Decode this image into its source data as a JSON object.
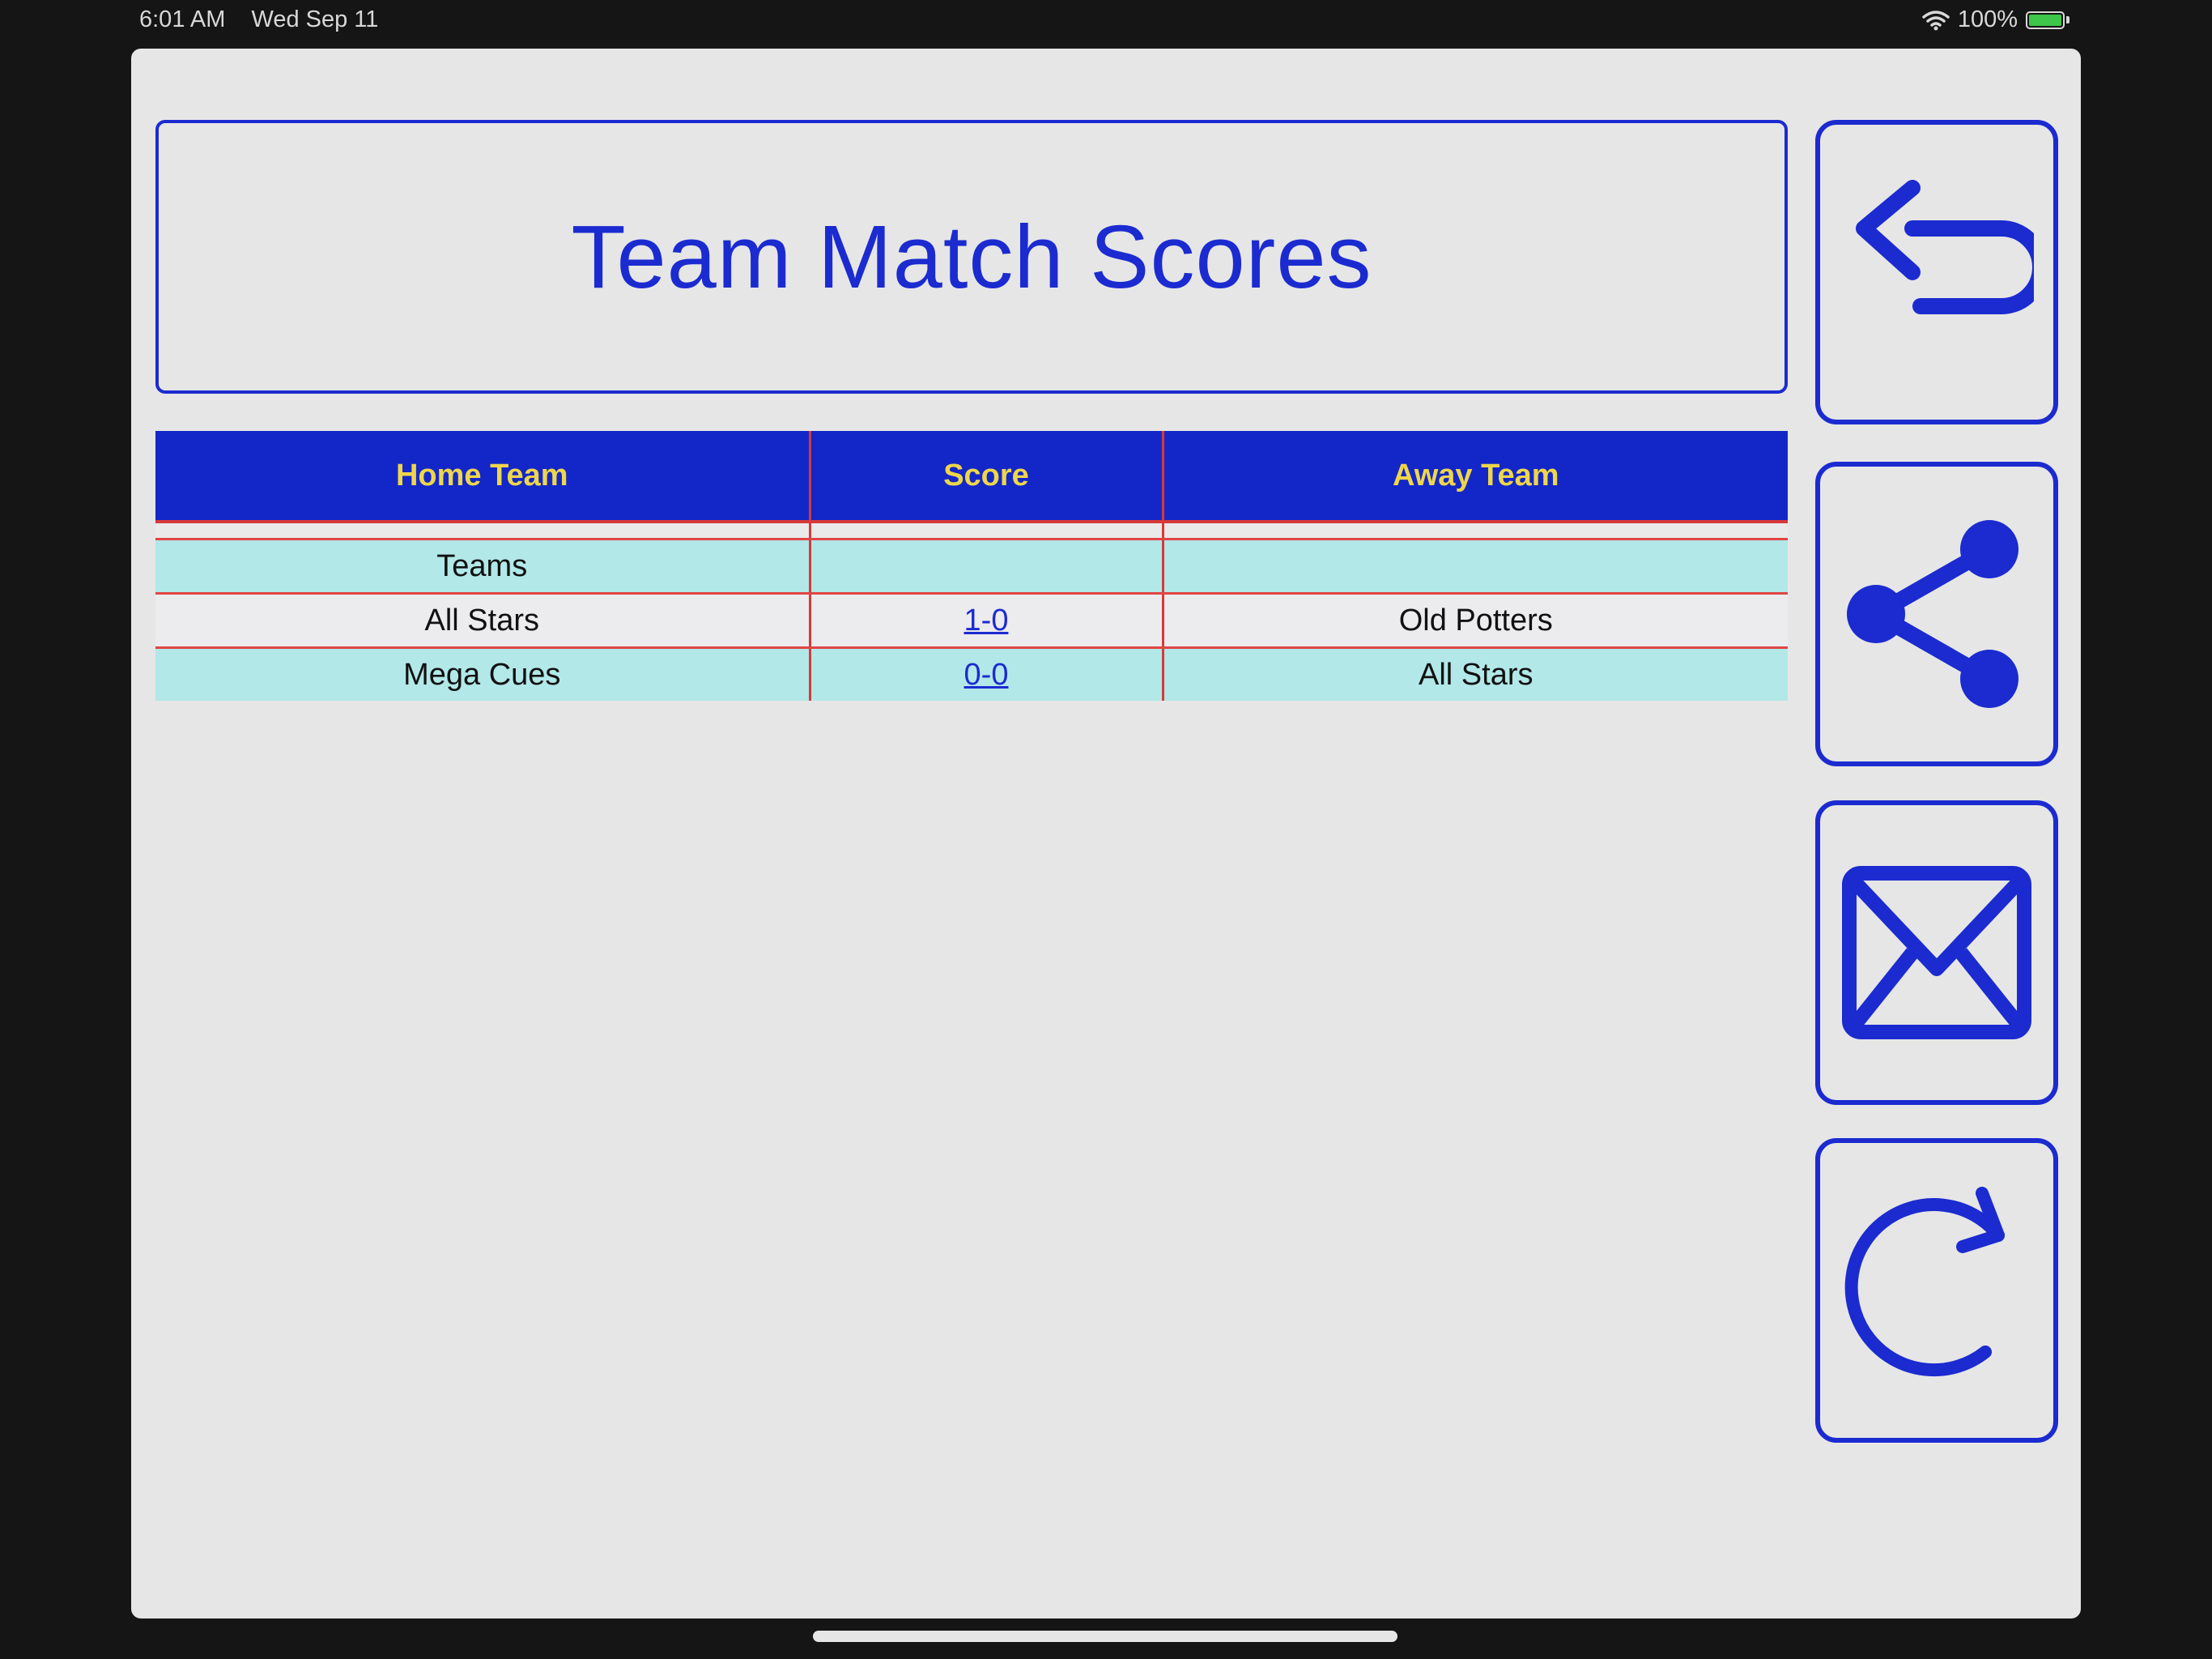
{
  "status_bar": {
    "time": "6:01 AM",
    "date": "Wed Sep 11",
    "battery": "100%",
    "wifi_icon": "wifi-icon",
    "battery_icon": "battery-icon"
  },
  "header": {
    "title": "Team Match Scores"
  },
  "table": {
    "columns": [
      "Home Team",
      "Score",
      "Away Team"
    ],
    "rows": [
      {
        "home": "Teams",
        "score": "",
        "away": ""
      },
      {
        "home": "All Stars",
        "score": "1-0",
        "away": "Old Potters"
      },
      {
        "home": "Mega Cues",
        "score": "0-0",
        "away": "All Stars"
      }
    ]
  },
  "side_buttons": [
    {
      "icon": "undo-icon"
    },
    {
      "icon": "share-icon"
    },
    {
      "icon": "mail-icon"
    },
    {
      "icon": "refresh-icon"
    }
  ],
  "colors": {
    "accent": "#1b2bd0",
    "header_text": "#eed64a",
    "row_cyan": "#b2e8e8",
    "divider_red": "#d63a3a"
  }
}
